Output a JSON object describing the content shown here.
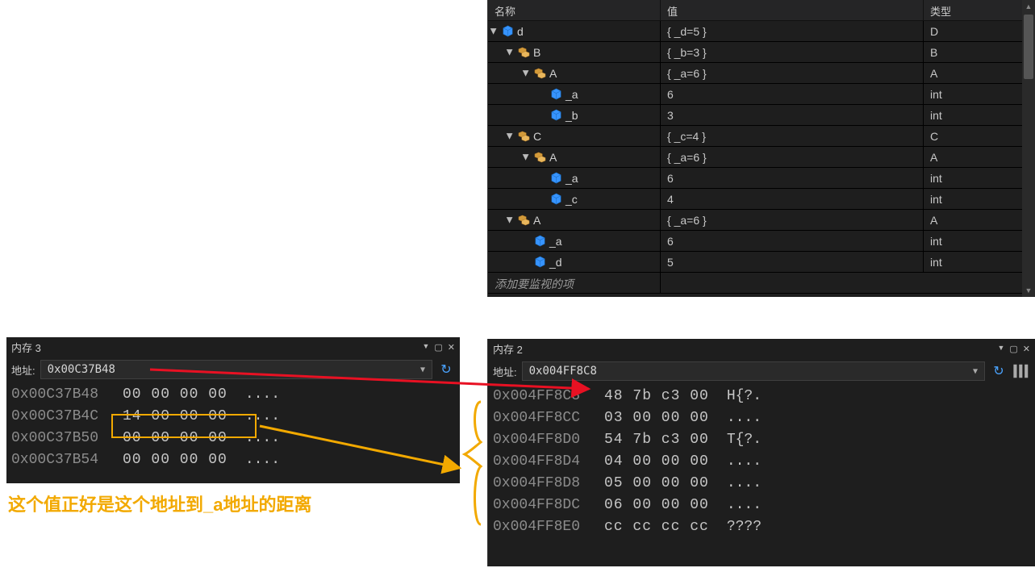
{
  "watch": {
    "headers": {
      "name": "名称",
      "value": "值",
      "type": "类型"
    },
    "placeholder": "添加要监视的项",
    "rows": [
      {
        "indent": 0,
        "expand": true,
        "icon": "cube-blue",
        "name": "d",
        "value": "{ _d=5 }",
        "type": "D"
      },
      {
        "indent": 1,
        "expand": true,
        "icon": "cube-orange",
        "name": "B",
        "value": "{ _b=3 }",
        "type": "B"
      },
      {
        "indent": 2,
        "expand": true,
        "icon": "cube-orange",
        "name": "A",
        "value": "{ _a=6 }",
        "type": "A"
      },
      {
        "indent": 3,
        "expand": false,
        "icon": "cube-blue",
        "name": "_a",
        "value": "6",
        "type": "int"
      },
      {
        "indent": 3,
        "expand": false,
        "icon": "cube-blue",
        "name": "_b",
        "value": "3",
        "type": "int"
      },
      {
        "indent": 1,
        "expand": true,
        "icon": "cube-orange",
        "name": "C",
        "value": "{ _c=4 }",
        "type": "C"
      },
      {
        "indent": 2,
        "expand": true,
        "icon": "cube-orange",
        "name": "A",
        "value": "{ _a=6 }",
        "type": "A"
      },
      {
        "indent": 3,
        "expand": false,
        "icon": "cube-blue",
        "name": "_a",
        "value": "6",
        "type": "int"
      },
      {
        "indent": 3,
        "expand": false,
        "icon": "cube-blue",
        "name": "_c",
        "value": "4",
        "type": "int"
      },
      {
        "indent": 1,
        "expand": true,
        "icon": "cube-orange",
        "name": "A",
        "value": "{ _a=6 }",
        "type": "A"
      },
      {
        "indent": 2,
        "expand": false,
        "icon": "cube-blue",
        "name": "_a",
        "value": "6",
        "type": "int"
      },
      {
        "indent": 2,
        "expand": false,
        "icon": "cube-blue",
        "name": "_d",
        "value": "5",
        "type": "int"
      }
    ]
  },
  "memory3": {
    "title": "内存 3",
    "addr_label": "地址:",
    "address": "0x00C37B48",
    "rows": [
      {
        "addr": "0x00C37B48",
        "bytes": "00 00 00 00",
        "ascii": "...."
      },
      {
        "addr": "0x00C37B4C",
        "bytes": "14 00 00 00",
        "ascii": "...."
      },
      {
        "addr": "0x00C37B50",
        "bytes": "00 00 00 00",
        "ascii": "...."
      },
      {
        "addr": "0x00C37B54",
        "bytes": "00 00 00 00",
        "ascii": "...."
      }
    ]
  },
  "memory2": {
    "title": "内存 2",
    "addr_label": "地址:",
    "address": "0x004FF8C8",
    "rows": [
      {
        "addr": "0x004FF8C8",
        "bytes": "48 7b c3 00",
        "ascii": "H{?."
      },
      {
        "addr": "0x004FF8CC",
        "bytes": "03 00 00 00",
        "ascii": "...."
      },
      {
        "addr": "0x004FF8D0",
        "bytes": "54 7b c3 00",
        "ascii": "T{?."
      },
      {
        "addr": "0x004FF8D4",
        "bytes": "04 00 00 00",
        "ascii": "...."
      },
      {
        "addr": "0x004FF8D8",
        "bytes": "05 00 00 00",
        "ascii": "...."
      },
      {
        "addr": "0x004FF8DC",
        "bytes": "06 00 00 00",
        "ascii": "...."
      },
      {
        "addr": "0x004FF8E0",
        "bytes": "cc cc cc cc",
        "ascii": "????"
      }
    ]
  },
  "annotation": "这个值正好是这个地址到_a地址的距离"
}
